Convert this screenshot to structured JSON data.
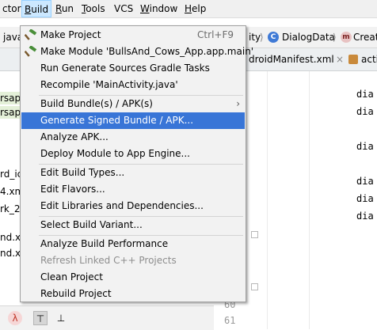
{
  "menubar": {
    "items": [
      {
        "label": "ctor",
        "u": ""
      },
      {
        "label": "uild",
        "u": "B"
      },
      {
        "label": "un",
        "u": "R"
      },
      {
        "label": "ools",
        "u": "T"
      },
      {
        "label": "VCS",
        "u": ""
      },
      {
        "label": "indow",
        "u": "W"
      },
      {
        "label": "elp",
        "u": "H"
      }
    ]
  },
  "nav": {
    "left_text": "java",
    "mid_text": "ity",
    "class_icon_letter": "C",
    "class_name": "DialogData",
    "method_icon_letter": "m",
    "method_name": "Create"
  },
  "tabs": {
    "manifest": "droidManifest.xml",
    "right_tab": "acti"
  },
  "tree": {
    "items": [
      "rsapp",
      "rsapp",
      "rd_ic",
      "4.xm",
      "rk_24",
      "nd.x",
      "nd.x"
    ]
  },
  "bottombar": {
    "icons": [
      "lambda-icon",
      "pin-icon",
      "pin-down-icon"
    ]
  },
  "gutter": {
    "numbers": [
      "60",
      "61"
    ]
  },
  "code": {
    "lines": [
      "dia",
      "dia",
      "dia",
      "dia",
      "dia",
      "dia"
    ]
  },
  "menu": {
    "items": [
      {
        "label": "Make Project",
        "shortcut": "Ctrl+F9"
      },
      {
        "label": "Make Module 'BullsAnd_Cows_App.app.main'",
        "shortcut": ""
      },
      {
        "label": "Run Generate Sources Gradle Tasks",
        "shortcut": ""
      },
      {
        "label": "Recompile 'MainActivity.java'",
        "shortcut": ""
      },
      {
        "label": "Build Bundle(s) / APK(s)",
        "shortcut": ""
      },
      {
        "label": "Generate Signed Bundle / APK...",
        "shortcut": ""
      },
      {
        "label": "Analyze APK...",
        "shortcut": ""
      },
      {
        "label": "Deploy Module to App Engine...",
        "shortcut": ""
      },
      {
        "label": "Edit Build Types...",
        "shortcut": ""
      },
      {
        "label": "Edit Flavors...",
        "shortcut": ""
      },
      {
        "label": "Edit Libraries and Dependencies...",
        "shortcut": ""
      },
      {
        "label": "Select Build Variant...",
        "shortcut": ""
      },
      {
        "label": "Analyze Build Performance",
        "shortcut": ""
      },
      {
        "label": "Refresh Linked C++ Projects",
        "shortcut": ""
      },
      {
        "label": "Clean Project",
        "shortcut": ""
      },
      {
        "label": "Rebuild Project",
        "shortcut": ""
      }
    ],
    "submenu_arrow": "›"
  },
  "colors": {
    "selection": "#3875d7",
    "menu_bg": "#f2f2f2",
    "menubar_active": "#cce8ff"
  }
}
